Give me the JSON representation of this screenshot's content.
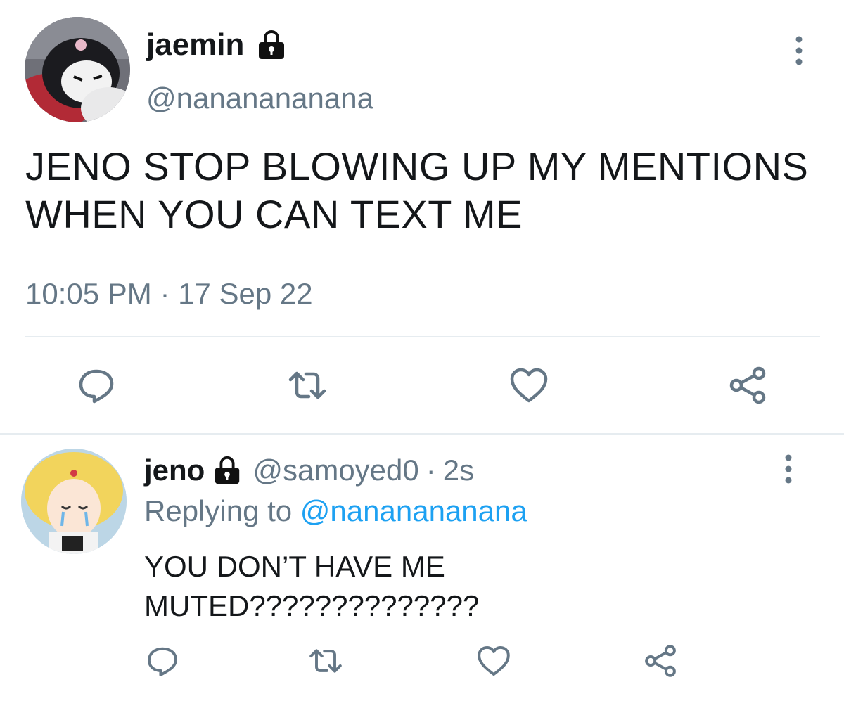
{
  "main_tweet": {
    "display_name": "jaemin",
    "handle": "@nananananana",
    "text": "JENO STOP BLOWING UP MY MENTIONS WHEN YOU CAN TEXT ME",
    "timestamp": "10:05 PM · 17 Sep 22",
    "icons": {
      "lock": "lock-icon",
      "more": "more-vertical-icon",
      "reply": "reply-icon",
      "retweet": "retweet-icon",
      "like": "heart-icon",
      "share": "share-icon"
    }
  },
  "reply_tweet": {
    "display_name": "jeno",
    "handle": "@samoyed0",
    "separator": "·",
    "time": "2s",
    "replying_prefix": "Replying to ",
    "replying_handle": "@nananananana",
    "text": "YOU DON’T HAVE ME MUTED??????????????"
  },
  "colors": {
    "text": "#14171a",
    "secondary": "#657786",
    "link": "#1da1f2",
    "divider": "#e6ecf0"
  }
}
